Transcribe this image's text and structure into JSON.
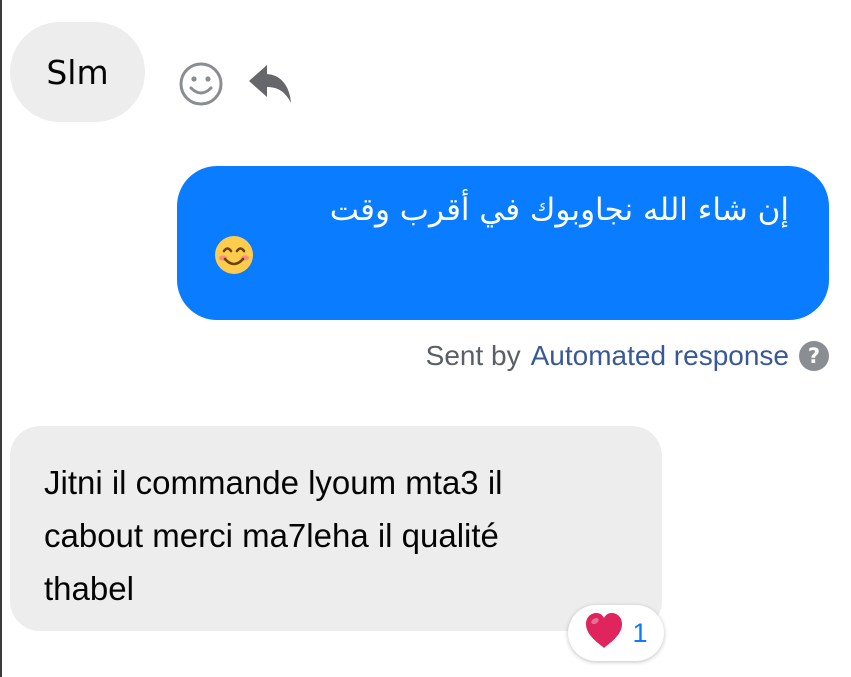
{
  "conversation": {
    "incoming_1": {
      "text": "Slm"
    },
    "incoming_1_actions": {
      "react_icon": "smiley-icon",
      "reply_icon": "reply-arrow-icon"
    },
    "outgoing_1": {
      "text": "إن شاء الله نجاوبوك في أقرب وقت",
      "emoji": "smiling-face-emoji",
      "bubble_color": "#0a7cff"
    },
    "sent_by": {
      "prefix": "Sent by",
      "link": "Automated response",
      "help_icon": "question-mark-icon"
    },
    "incoming_2": {
      "line1": "Jitni il commande lyoum mta3 il",
      "line2": "cabout merci ma7leha il qualité",
      "line3": "thabel"
    },
    "reaction": {
      "icon": "heart-icon",
      "count": "1",
      "color": "#e0245e"
    }
  }
}
